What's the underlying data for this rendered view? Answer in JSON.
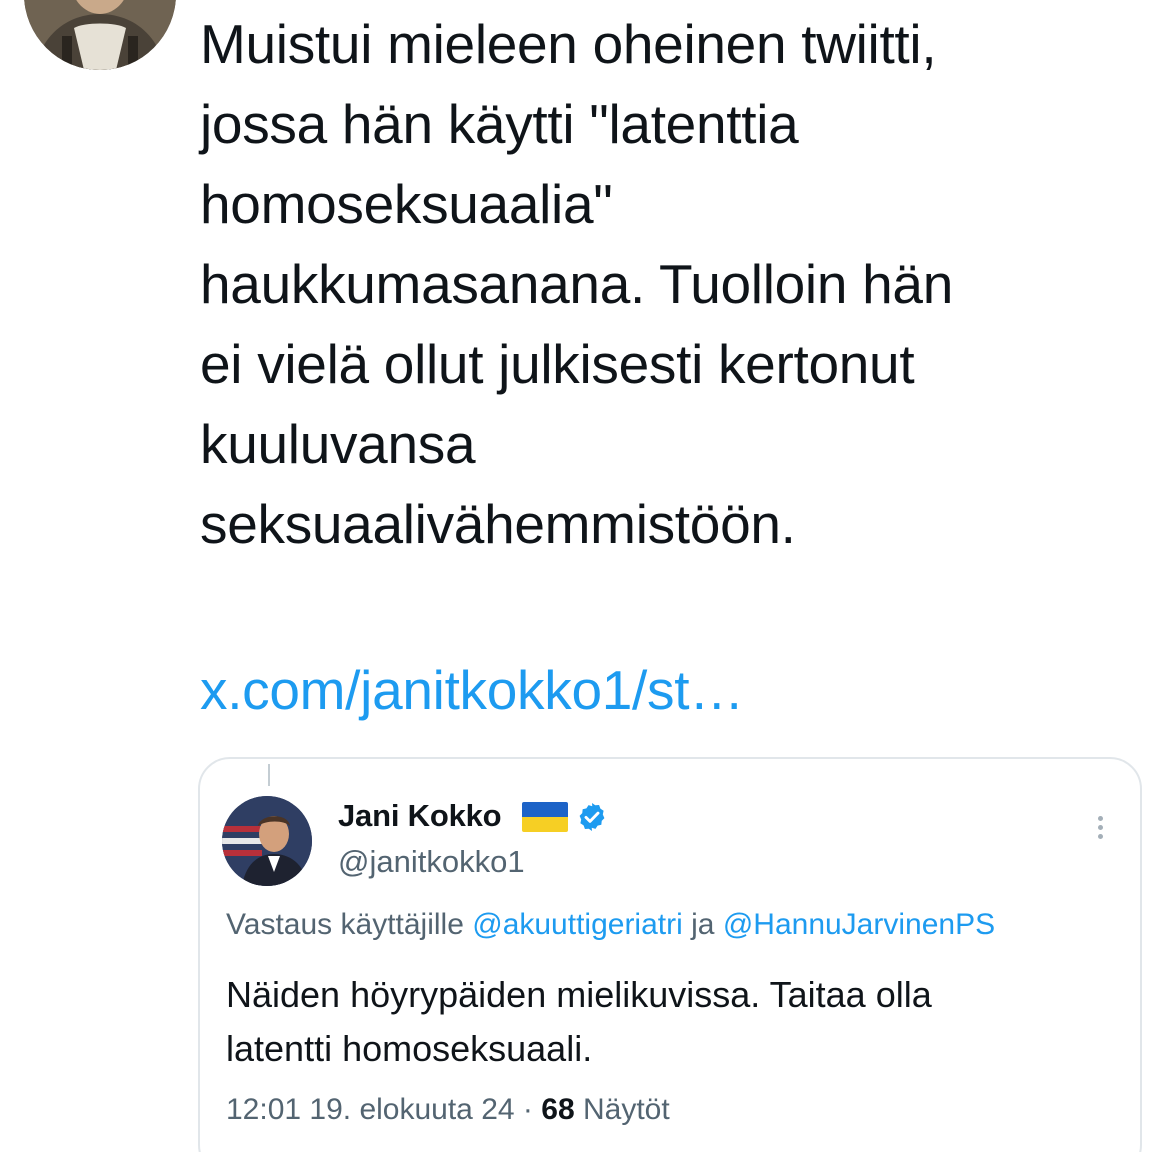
{
  "tweet": {
    "text": "Muistui mieleen oheinen twiitti,\njossa hän käytti \"latenttia\nhomoseksuaalia\"\nhaukkumasanana. Tuolloin hän\nei vielä ollut julkisesti kertonut\nkuuluvansa\nseksuaalivähemmistöön.",
    "link": "x.com/janitkokko1/st…"
  },
  "quote": {
    "name": "Jani Kokko",
    "handle": "@janitkokko1",
    "reply_prefix": "Vastaus käyttäjille",
    "mention_1": "@akuuttigeriatri",
    "reply_joiner": "ja",
    "mention_2": "@HannuJarvinenPS",
    "body": "Näiden höyrypäiden mielikuvissa. Taitaa olla\nlatentti homoseksuaali.",
    "time": "12:01 19. elokuuta 24",
    "separator": "·",
    "views": "68",
    "views_label": "Näytöt"
  },
  "icons": {
    "flag": "ukraine-flag-icon",
    "verified": "verified-badge-icon",
    "more": "more-options-icon"
  },
  "colors": {
    "link": "#1d9bf0",
    "text": "#0f1419",
    "secondary": "#536471",
    "border": "#e1e6ea",
    "verified": "#1d9bf0",
    "flag_blue": "#1d63c7",
    "flag_yellow": "#f6cf24"
  }
}
